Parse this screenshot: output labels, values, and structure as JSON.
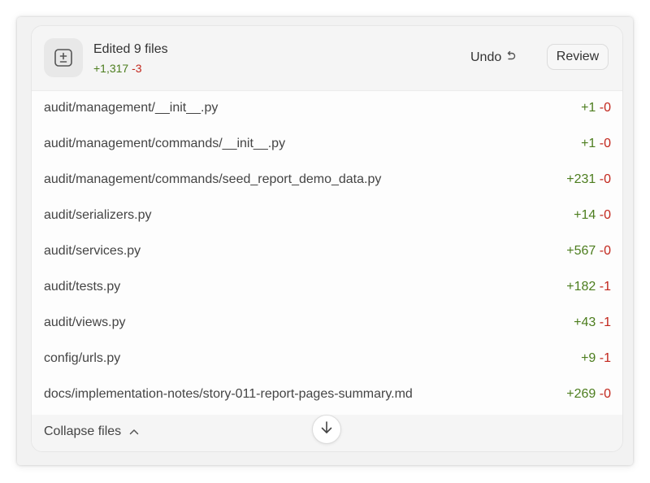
{
  "summary": {
    "title": "Edited 9 files",
    "additions": "+1,317",
    "deletions": "-3"
  },
  "actions": {
    "undo_label": "Undo",
    "review_label": "Review"
  },
  "files": [
    {
      "path": "audit/management/__init__.py",
      "additions": "+1",
      "deletions": "-0"
    },
    {
      "path": "audit/management/commands/__init__.py",
      "additions": "+1",
      "deletions": "-0"
    },
    {
      "path": "audit/management/commands/seed_report_demo_data.py",
      "additions": "+231",
      "deletions": "-0"
    },
    {
      "path": "audit/serializers.py",
      "additions": "+14",
      "deletions": "-0"
    },
    {
      "path": "audit/services.py",
      "additions": "+567",
      "deletions": "-0"
    },
    {
      "path": "audit/tests.py",
      "additions": "+182",
      "deletions": "-1"
    },
    {
      "path": "audit/views.py",
      "additions": "+43",
      "deletions": "-1"
    },
    {
      "path": "config/urls.py",
      "additions": "+9",
      "deletions": "-1"
    },
    {
      "path": "docs/implementation-notes/story-011-report-pages-summary.md",
      "additions": "+269",
      "deletions": "-0"
    }
  ],
  "footer": {
    "collapse_label": "Collapse files"
  },
  "icons": {
    "diff": "plus-minus-icon",
    "undo": "undo-arrow-icon",
    "collapse": "chevron-up-icon",
    "scroll": "arrow-down-icon"
  },
  "colors": {
    "additions": "#4c7d1e",
    "deletions": "#c2261c"
  }
}
